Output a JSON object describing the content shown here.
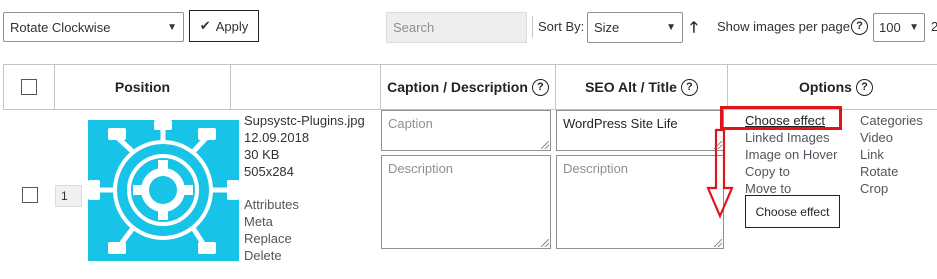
{
  "toolbar": {
    "bulk_action": "Rotate Clockwise",
    "apply_label": "Apply",
    "search_placeholder": "Search",
    "sort_by_label": "Sort By:",
    "sort_value": "Size",
    "per_page_label": "Show images per page",
    "per_page_value": "100",
    "page_count": "2"
  },
  "table": {
    "headers": {
      "position": "Position",
      "caption": "Caption / Description",
      "seo": "SEO Alt / Title",
      "options": "Options"
    },
    "row": {
      "position": "1",
      "file_name": "Supsystc-Plugins.jpg",
      "date": "12.09.2018",
      "size": "30 KB",
      "dimensions": "505x284",
      "links": [
        "Attributes",
        "Meta",
        "Replace",
        "Delete"
      ],
      "caption_placeholder": "Caption",
      "description_placeholder": "Description",
      "seo_alt": "WordPress Site Life",
      "seo_title_placeholder": "Description",
      "options_col1": [
        "Choose effect",
        "Linked Images",
        "Image on Hover",
        "Copy to",
        "Move to"
      ],
      "options_col2": [
        "Categories",
        "Video",
        "Link",
        "Rotate",
        "Crop"
      ],
      "tooltip_label": "Choose effect"
    }
  },
  "colors": {
    "highlight": "#e0151b",
    "thumbnail_bg": "#18c3e8"
  }
}
